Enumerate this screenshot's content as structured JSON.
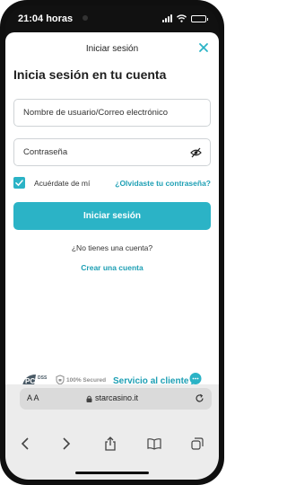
{
  "status_bar": {
    "time": "21:04 horas",
    "signal": "signal-bars-icon",
    "wifi": "wifi-icon",
    "battery": "battery-icon"
  },
  "modal": {
    "title": "Iniciar sesión",
    "close_icon": "close-icon",
    "heading": "Inicia sesión en tu cuenta",
    "username_placeholder": "Nombre de usuario/Correo electrónico",
    "password_placeholder": "Contraseña",
    "password_visibility_icon": "eye-off-icon",
    "remember_checked": true,
    "remember_label": "Acuérdate de mí",
    "forgot_label": "¿Olvidaste tu contraseña?",
    "submit_label": "Iniciar sesión",
    "no_account_text": "¿No tienes una cuenta?",
    "create_account_label": "Crear una cuenta"
  },
  "footer": {
    "pci_logo_text": "PCI DSS",
    "secured_text": "100% Secured",
    "service_label": "Servicio al cliente",
    "service_icon": "chat-bubble-icon"
  },
  "browser": {
    "aa_label": "A A",
    "url": "starcasino.it",
    "toolbar_icons": [
      "back-icon",
      "forward-icon",
      "share-icon",
      "bookmarks-icon",
      "tabs-icon"
    ]
  },
  "colors": {
    "accent": "#2bb3c6",
    "link": "#1d9fb4"
  }
}
